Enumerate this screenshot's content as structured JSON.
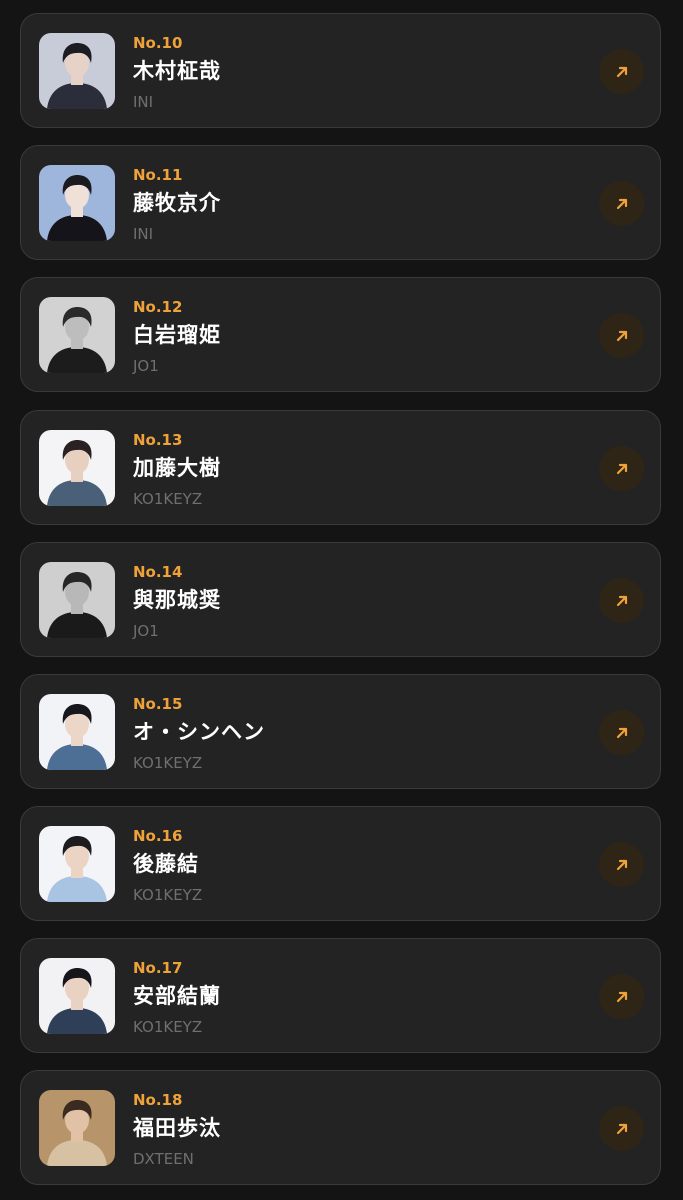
{
  "items": [
    {
      "rank": "No.10",
      "name": "木村柾哉",
      "group": "INI",
      "icon": "arrow-up-right-icon",
      "avatar": {
        "bg": "#c8ccd8",
        "hair": "#1c1c22",
        "skin": "#e6d2c6",
        "outfit": "#2b2e3a"
      }
    },
    {
      "rank": "No.11",
      "name": "藤牧京介",
      "group": "INI",
      "icon": "arrow-up-right-icon",
      "avatar": {
        "bg": "#9fb6dc",
        "hair": "#1a1a1f",
        "skin": "#efe0d8",
        "outfit": "#14141a"
      }
    },
    {
      "rank": "No.12",
      "name": "白岩瑠姫",
      "group": "JO1",
      "icon": "arrow-up-right-icon",
      "avatar": {
        "bg": "#d2d2d2",
        "hair": "#2a2a2a",
        "skin": "#bdbdbd",
        "outfit": "#1c1c1c"
      }
    },
    {
      "rank": "No.13",
      "name": "加藤大樹",
      "group": "KO1KEYZ",
      "icon": "arrow-up-right-icon",
      "avatar": {
        "bg": "#f4f4f6",
        "hair": "#2a2222",
        "skin": "#e8d0c0",
        "outfit": "#4a5f78"
      }
    },
    {
      "rank": "No.14",
      "name": "與那城奨",
      "group": "JO1",
      "icon": "arrow-up-right-icon",
      "avatar": {
        "bg": "#cfcfcf",
        "hair": "#262626",
        "skin": "#b8b8b8",
        "outfit": "#1a1a1a"
      }
    },
    {
      "rank": "No.15",
      "name": "オ・シンヘン",
      "group": "KO1KEYZ",
      "icon": "arrow-up-right-icon",
      "avatar": {
        "bg": "#f2f3f6",
        "hair": "#16161c",
        "skin": "#ecd6c8",
        "outfit": "#4d6f96"
      }
    },
    {
      "rank": "No.16",
      "name": "後藤結",
      "group": "KO1KEYZ",
      "icon": "arrow-up-right-icon",
      "avatar": {
        "bg": "#f3f4f7",
        "hair": "#1d1b1d",
        "skin": "#ecd4c4",
        "outfit": "#a9c3e2"
      }
    },
    {
      "rank": "No.17",
      "name": "安部結蘭",
      "group": "KO1KEYZ",
      "icon": "arrow-up-right-icon",
      "avatar": {
        "bg": "#f2f2f4",
        "hair": "#15151a",
        "skin": "#ead2c2",
        "outfit": "#2f3f58"
      }
    },
    {
      "rank": "No.18",
      "name": "福田歩汰",
      "group": "DXTEEN",
      "icon": "arrow-up-right-icon",
      "avatar": {
        "bg": "#b8946a",
        "hair": "#3a2a20",
        "skin": "#e2c2a6",
        "outfit": "#d6c2a2"
      }
    }
  ],
  "colors": {
    "accent": "#f0a23a",
    "card_bg": "#232323",
    "card_border": "#3a3a3a",
    "page_bg": "#141414",
    "button_bg": "#2e2517"
  }
}
